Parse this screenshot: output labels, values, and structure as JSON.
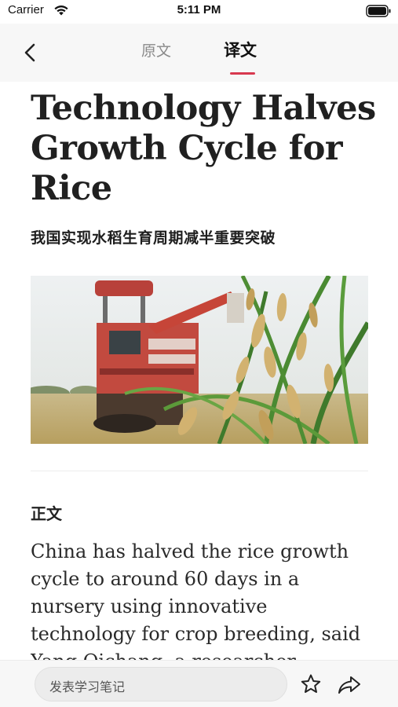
{
  "status_bar": {
    "carrier": "Carrier",
    "time": "5:11 PM",
    "wifi_icon": "wifi-icon",
    "battery_icon": "battery-icon"
  },
  "nav": {
    "back_icon": "chevron-left-icon",
    "tabs": [
      {
        "label": "原文",
        "active": false
      },
      {
        "label": "译文",
        "active": true
      }
    ],
    "indicator_color": "#d8394f"
  },
  "article": {
    "title": "Technology Halves Growth Cycle for Rice",
    "subtitle": "我国实现水稻生育周期减半重要突破",
    "image_subject": "rice-harvester-photo",
    "section_heading": "正文",
    "body": "China has halved the rice growth cycle to around 60 days in a nursery using innovative technology for crop breeding, said Yang Qichang, a researcher"
  },
  "bottom_bar": {
    "note_placeholder": "发表学习笔记",
    "star_icon": "star-icon",
    "share_icon": "share-icon"
  }
}
